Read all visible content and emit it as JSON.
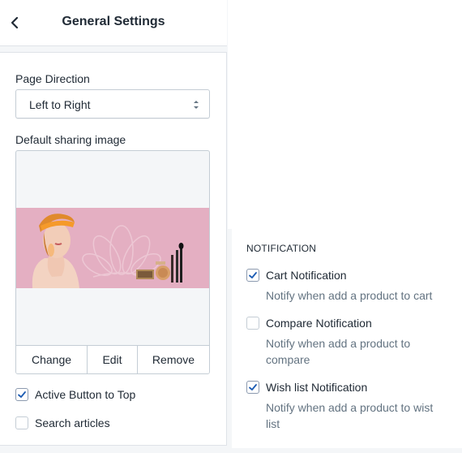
{
  "header": {
    "back_icon": "chevron-left-icon",
    "title": "General Settings"
  },
  "page_direction": {
    "label": "Page Direction",
    "selected": "Left to Right",
    "icon": "select-arrows-icon"
  },
  "sharing_image": {
    "label": "Default sharing image",
    "change_label": "Change",
    "edit_label": "Edit",
    "remove_label": "Remove"
  },
  "options": [
    {
      "label": "Active Button to Top",
      "checked": true
    },
    {
      "label": "Search articles",
      "checked": false
    }
  ],
  "notification": {
    "heading": "NOTIFICATION",
    "items": [
      {
        "label": "Cart Notification",
        "description": "Notify when add a product to cart",
        "checked": true
      },
      {
        "label": "Compare Notification",
        "description": "Notify when add a product to compare",
        "checked": false
      },
      {
        "label": "Wish list Notification",
        "description": "Notify when add a product to wist list",
        "checked": true
      }
    ]
  },
  "colors": {
    "banner_pink": "#e4afc2",
    "checkbox_check": "#1b5bb3",
    "border": "#c4cdd5"
  }
}
